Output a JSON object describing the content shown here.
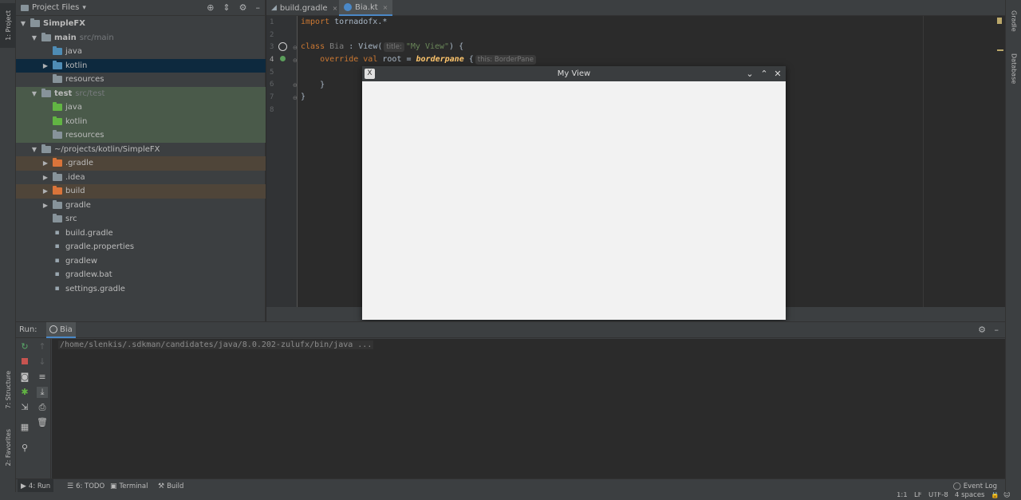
{
  "stripes": {
    "left_top": "1: Project",
    "left_structure": "7: Structure",
    "left_favorites": "2: Favorites",
    "right_gradle": "Gradle",
    "right_database": "Database"
  },
  "project": {
    "header_label": "Project Files",
    "header_dropdown_glyph": "▾",
    "tree": [
      {
        "label": "SimpleFX",
        "sub": "",
        "arrow": "▼",
        "level": 0,
        "icon": "module-icon",
        "color": "#87939a",
        "bold": true
      },
      {
        "label": "main",
        "sub": "src/main",
        "arrow": "▼",
        "level": 1,
        "icon": "folder-icon",
        "color": "#87939a",
        "bold": true
      },
      {
        "label": "java",
        "sub": "",
        "arrow": "",
        "level": 2,
        "icon": "source-folder-icon",
        "color": "#4e8cb5",
        "bold": false
      },
      {
        "label": "kotlin",
        "sub": "",
        "arrow": "▶",
        "level": 2,
        "icon": "source-folder-icon",
        "color": "#4e8cb5",
        "bold": false
      },
      {
        "label": "resources",
        "sub": "",
        "arrow": "",
        "level": 2,
        "icon": "resources-folder-icon",
        "color": "#87939a",
        "bold": false
      },
      {
        "label": "test",
        "sub": "src/test",
        "arrow": "▼",
        "level": 1,
        "icon": "folder-icon",
        "color": "#87939a",
        "bold": true
      },
      {
        "label": "java",
        "sub": "",
        "arrow": "",
        "level": 2,
        "icon": "test-folder-icon",
        "color": "#62b543",
        "bold": false
      },
      {
        "label": "kotlin",
        "sub": "",
        "arrow": "",
        "level": 2,
        "icon": "test-folder-icon",
        "color": "#62b543",
        "bold": false
      },
      {
        "label": "resources",
        "sub": "",
        "arrow": "",
        "level": 2,
        "icon": "test-resources-folder-icon",
        "color": "#87939a",
        "bold": false
      },
      {
        "label": "~/projects/kotlin/SimpleFX",
        "sub": "",
        "arrow": "▼",
        "level": 1,
        "icon": "folder-icon",
        "color": "#87939a",
        "bold": false
      },
      {
        "label": ".gradle",
        "sub": "",
        "arrow": "▶",
        "level": 2,
        "icon": "excluded-folder-icon",
        "color": "#d9743a",
        "bold": false
      },
      {
        "label": ".idea",
        "sub": "",
        "arrow": "▶",
        "level": 2,
        "icon": "folder-icon",
        "color": "#87939a",
        "bold": false
      },
      {
        "label": "build",
        "sub": "",
        "arrow": "▶",
        "level": 2,
        "icon": "excluded-folder-icon",
        "color": "#d9743a",
        "bold": false
      },
      {
        "label": "gradle",
        "sub": "",
        "arrow": "▶",
        "level": 2,
        "icon": "folder-icon",
        "color": "#87939a",
        "bold": false
      },
      {
        "label": "src",
        "sub": "",
        "arrow": "",
        "level": 2,
        "icon": "folder-icon",
        "color": "#87939a",
        "bold": false
      },
      {
        "label": "build.gradle",
        "sub": "",
        "arrow": "",
        "level": 2,
        "icon": "gradle-file-icon",
        "color": "#9aa7b0",
        "bold": false
      },
      {
        "label": "gradle.properties",
        "sub": "",
        "arrow": "",
        "level": 2,
        "icon": "properties-file-icon",
        "color": "#9aa7b0",
        "bold": false
      },
      {
        "label": "gradlew",
        "sub": "",
        "arrow": "",
        "level": 2,
        "icon": "shell-file-icon",
        "color": "#9aa7b0",
        "bold": false
      },
      {
        "label": "gradlew.bat",
        "sub": "",
        "arrow": "",
        "level": 2,
        "icon": "text-file-icon",
        "color": "#9aa7b0",
        "bold": false
      },
      {
        "label": "settings.gradle",
        "sub": "",
        "arrow": "",
        "level": 2,
        "icon": "gradle-file-icon",
        "color": "#9aa7b0",
        "bold": false
      }
    ]
  },
  "editor": {
    "tabs": [
      {
        "label": "build.gradle",
        "icon": "gradle-file-icon",
        "active": false
      },
      {
        "label": "Bia.kt",
        "icon": "kotlin-file-icon",
        "active": true
      }
    ],
    "line_numbers": [
      "1",
      "2",
      "3",
      "4",
      "5",
      "6",
      "7",
      "8"
    ],
    "code": {
      "l1_kw": "import",
      "l1_rest": " tornadofx.*",
      "l3_kw": "class",
      "l3_cls": " Bia",
      "l3_mid": " : View(",
      "l3_hint": "title:",
      "l3_str": "\"My View\"",
      "l3_end": ") {",
      "l4_kw": "override val",
      "l4_prop": " root = ",
      "l4_fn": "borderpane",
      "l4_brace": " {",
      "l4_hint": "this: BorderPane",
      "l6": "    }",
      "l7": "}"
    }
  },
  "floating_window": {
    "title": "My View",
    "app_icon_glyph": "X",
    "minimize_glyph": "⌄",
    "maximize_glyph": "⌃",
    "close_glyph": "✕"
  },
  "run": {
    "label": "Run:",
    "tab_label": "Bia",
    "console_line": "/home/slenkis/.sdkman/candidates/java/8.0.202-zulufx/bin/java ..."
  },
  "bottom_tabs": [
    {
      "label": "4: Run",
      "icon": "▶",
      "active": true
    },
    {
      "label": "6: TODO",
      "icon": "☰",
      "active": false
    },
    {
      "label": "Terminal",
      "icon": "▣",
      "active": false
    },
    {
      "label": "Build",
      "icon": "⚒",
      "active": false
    }
  ],
  "event_log": "Event Log",
  "status": {
    "position": "1:1",
    "line_sep": "LF",
    "encoding": "UTF-8",
    "indent": "4 spaces"
  }
}
